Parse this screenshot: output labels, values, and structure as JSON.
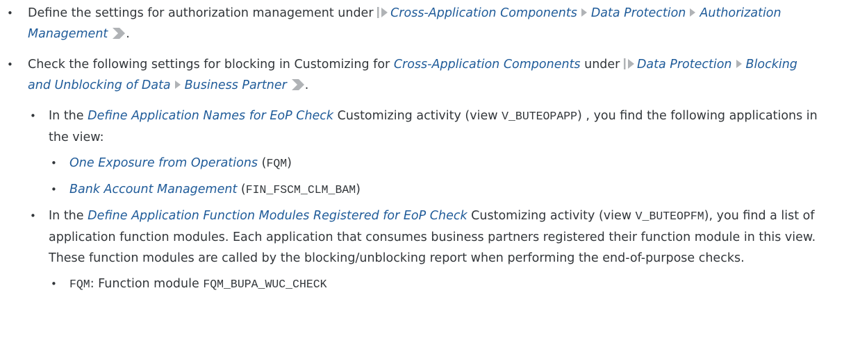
{
  "bullet_glyph": "•",
  "item1": {
    "text_before": "Define the settings for authorization management under ",
    "path": [
      "Cross-Application Components",
      "Data Protection",
      "Authorization Management"
    ],
    "text_after": "."
  },
  "item2": {
    "text_before": "Check the following settings for blocking in Customizing for ",
    "link1": "Cross-Application Components",
    "text_middle": " under ",
    "path": [
      "Data Protection",
      "Blocking and Unblocking of Data",
      "Business Partner"
    ],
    "text_after": "."
  },
  "item3": {
    "text_before": "In the ",
    "link": "Define Application Names for EoP Check",
    "text_middle": " Customizing activity (view ",
    "code": "V_BUTEOPAPP",
    "text_after": ") , you find the following applications in the view:"
  },
  "item4": {
    "link": "One Exposure from Operations",
    "text_middle": " (",
    "code": "FQM",
    "text_after": ")"
  },
  "item5": {
    "link": "Bank Account Management",
    "text_middle": " (",
    "code": "FIN_FSCM_CLM_BAM",
    "text_after": ")"
  },
  "item6": {
    "text_before": "In the ",
    "link": "Define Application Function Modules Registered for EoP Check",
    "text_middle": " Customizing activity (view ",
    "code": "V_BUTEOPFM",
    "text_after": "), you find a list of application function modules. Each application that consumes business partners registered their function module in this view. These function modules are called by the blocking/unblocking report when performing the end-of-purpose checks."
  },
  "item7": {
    "code1": "FQM",
    "text_middle": ": Function module ",
    "code2": "FQM_BUPA_WUC_CHECK"
  },
  "colors": {
    "text": "#32363a",
    "link": "#1f5b99",
    "path_icon": "#b0b3b6"
  },
  "icons": {
    "path_start": "path-start-icon",
    "path_separator": "path-separator-icon",
    "path_end": "path-end-icon"
  }
}
